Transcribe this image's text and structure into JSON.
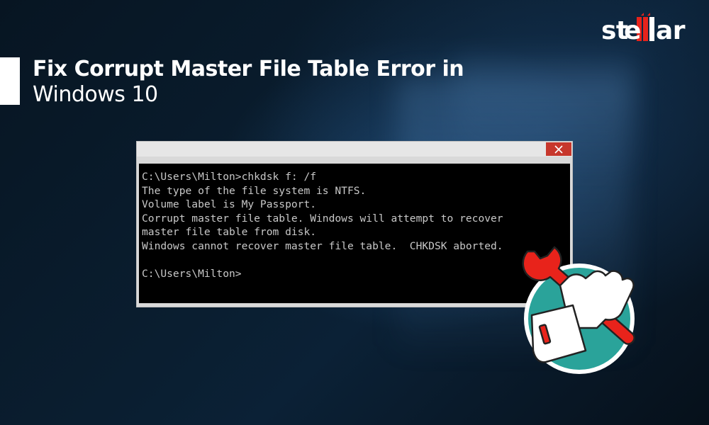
{
  "brand": {
    "logo_text": "stellar"
  },
  "headline": {
    "line1": "Fix Corrupt Master File Table Error in",
    "line2": "Windows 10"
  },
  "console": {
    "close_icon": "close-icon",
    "lines": [
      "C:\\Users\\Milton>chkdsk f: /f",
      "The type of the file system is NTFS.",
      "Volume label is My Passport.",
      "Corrupt master file table. Windows will attempt to recover",
      "master file table from disk.",
      "Windows cannot recover master file table.  CHKDSK aborted.",
      "",
      "C:\\Users\\Milton>"
    ]
  },
  "illustration": {
    "icon": "hand-wrench-icon"
  },
  "colors": {
    "accent": "#e8231b",
    "teal": "#2aa39a",
    "console_bg": "#000000"
  }
}
